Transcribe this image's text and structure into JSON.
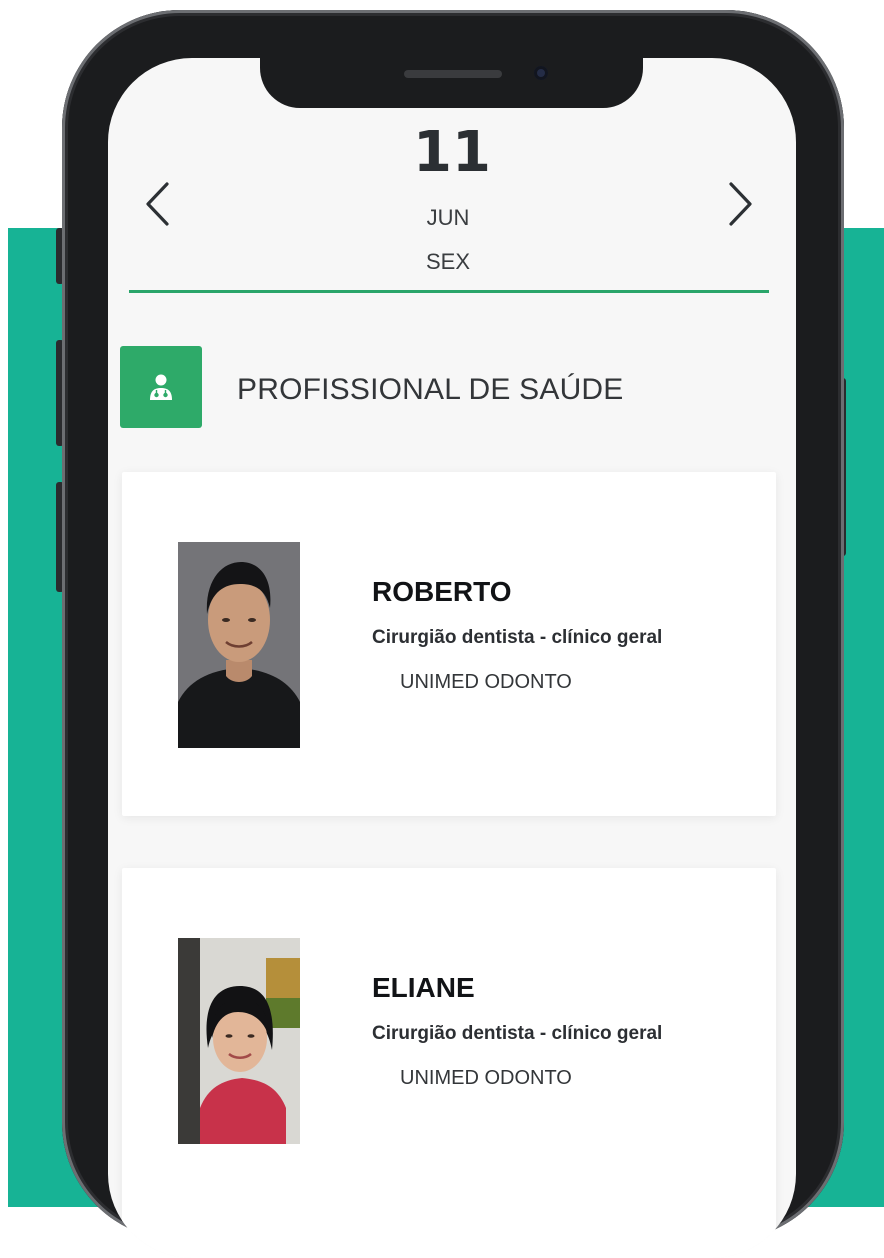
{
  "colors": {
    "background_accent": "#17b395",
    "primary_green": "#2eaa69",
    "divider_green": "#2aa56a"
  },
  "date_selector": {
    "day": "11",
    "month": "JUN",
    "weekday": "SEX",
    "prev_icon": "chevron-left-icon",
    "next_icon": "chevron-right-icon"
  },
  "section": {
    "icon": "doctor-icon",
    "title": "PROFISSIONAL DE SAÚDE"
  },
  "professionals": [
    {
      "name": "ROBERTO",
      "specialty": "Cirurgião dentista - clínico geral",
      "plan": "UNIMED ODONTO"
    },
    {
      "name": "ELIANE",
      "specialty": "Cirurgião dentista - clínico geral",
      "plan": "UNIMED ODONTO"
    }
  ]
}
